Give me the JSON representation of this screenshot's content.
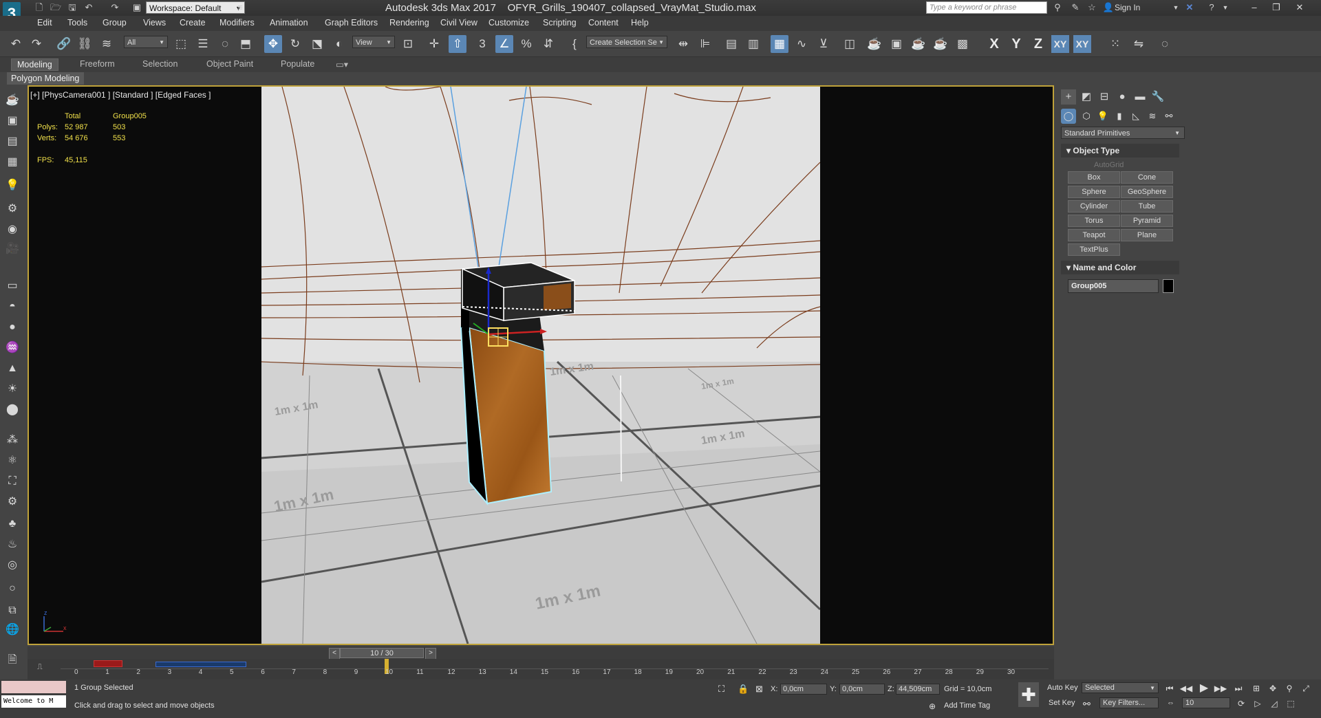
{
  "title": {
    "app": "Autodesk 3ds Max 2017",
    "file": "OFYR_Grills_190407_collapsed_VrayMat_Studio.max",
    "workspace": "Workspace: Default",
    "search_placeholder": "Type a keyword or phrase",
    "sign_in": "Sign In",
    "logo": "3"
  },
  "menu": [
    "Edit",
    "Tools",
    "Group",
    "Views",
    "Create",
    "Modifiers",
    "Animation",
    "Graph Editors",
    "Rendering",
    "Civil View",
    "Customize",
    "Scripting",
    "Content",
    "Help"
  ],
  "toolbar": {
    "selection_filter": "All",
    "ref_coord": "View",
    "named_selection": "Create Selection Se",
    "axes": [
      "X",
      "Y",
      "Z",
      "XY",
      "XY"
    ]
  },
  "ribbon": {
    "tabs": [
      "Modeling",
      "Freeform",
      "Selection",
      "Object Paint",
      "Populate"
    ],
    "active": "Modeling",
    "sub": "Polygon Modeling"
  },
  "viewport": {
    "label": "[+] [PhysCamera001 ] [Standard ] [Edged Faces ]",
    "stats": {
      "col_total": "Total",
      "col_group": "Group005",
      "polys_label": "Polys:",
      "polys_total": "52 987",
      "polys_group": "503",
      "verts_label": "Verts:",
      "verts_total": "54 676",
      "verts_group": "553",
      "fps_label": "FPS:",
      "fps_value": "45,115"
    },
    "grid_labels": [
      "1m x 1m",
      "1m x 1m",
      "1m x 1m",
      "1m x 1m",
      "1m x 1m",
      "1m x 1m"
    ],
    "axis_tripod": {
      "x": "x",
      "z": "z"
    }
  },
  "command_panel": {
    "category_dropdown": "Standard Primitives",
    "object_type_title": "Object Type",
    "autogrid": "AutoGrid",
    "buttons": [
      "Box",
      "Cone",
      "Sphere",
      "GeoSphere",
      "Cylinder",
      "Tube",
      "Torus",
      "Pyramid",
      "Teapot",
      "Plane",
      "TextPlus"
    ],
    "name_color_title": "Name and Color",
    "object_name": "Group005",
    "object_color": "#000000"
  },
  "timeline": {
    "frame": "10 / 30",
    "ticks": [
      "0",
      "1",
      "2",
      "3",
      "4",
      "5",
      "6",
      "7",
      "8",
      "9",
      "10",
      "11",
      "12",
      "13",
      "14",
      "15",
      "16",
      "17",
      "18",
      "19",
      "20",
      "21",
      "22",
      "23",
      "24",
      "25",
      "26",
      "27",
      "28",
      "29",
      "30"
    ],
    "current_frame": 10
  },
  "status": {
    "maxscript": "Welcome to M",
    "selection": "1 Group Selected",
    "prompt": "Click and drag to select and move objects",
    "x_label": "X:",
    "x_value": "0,0cm",
    "y_label": "Y:",
    "y_value": "0,0cm",
    "z_label": "Z:",
    "z_value": "44,509cm",
    "grid": "Grid = 10,0cm",
    "add_time_tag": "Add Time Tag",
    "auto_key": "Auto Key",
    "set_key": "Set Key",
    "selected": "Selected",
    "key_filters": "Key Filters...",
    "frame_field": "10"
  },
  "colors": {
    "accent": "#5b87b5",
    "viewport_border": "#bfa23a",
    "stats": "#f0e04a",
    "wood": "#a8611e"
  }
}
